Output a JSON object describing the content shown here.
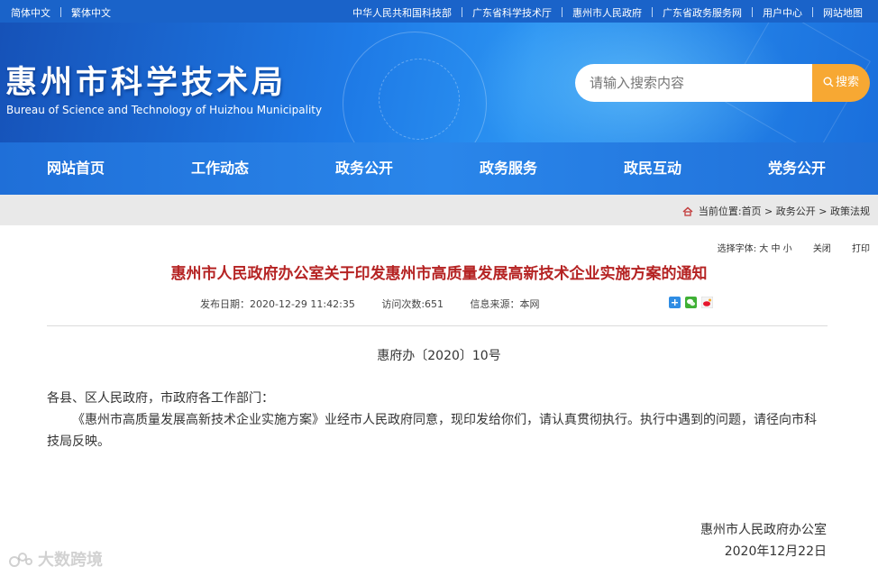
{
  "topbar": {
    "lang_simplified": "简体中文",
    "lang_traditional": "繁体中文",
    "links": [
      "中华人民共和国科技部",
      "广东省科学技术厅",
      "惠州市人民政府",
      "广东省政务服务网",
      "用户中心",
      "网站地图"
    ]
  },
  "header": {
    "title": "惠州市科学技术局",
    "subtitle": "Bureau of Science and Technology of Huizhou Municipality",
    "search_placeholder": "请输入搜索内容",
    "search_button": "搜索"
  },
  "nav": [
    "网站首页",
    "工作动态",
    "政务公开",
    "政务服务",
    "政民互动",
    "党务公开"
  ],
  "breadcrumb": {
    "prefix": "当前位置",
    "items": [
      "首页",
      "政务公开",
      "政策法规"
    ]
  },
  "tools": {
    "font_label": "选择字体",
    "sizes": [
      "大",
      "中",
      "小"
    ],
    "close": "关闭",
    "print": "打印"
  },
  "article": {
    "title": "惠州市人民政府办公室关于印发惠州市高质量发展高新技术企业实施方案的通知",
    "publish_date_label": "发布日期：2020-12-29 11:42:35",
    "visits_label": "访问次数:651",
    "source_label": "信息来源：本网",
    "doc_no": "惠府办〔2020〕10号",
    "salutation": "各县、区人民政府，市政府各工作部门：",
    "paragraph": "《惠州市高质量发展高新技术企业实施方案》业经市人民政府同意，现印发给你们，请认真贯彻执行。执行中遇到的问题，请径向市科技局反映。",
    "signer": "惠州市人民政府办公室",
    "sign_date": "2020年12月22日"
  },
  "watermark": "大数跨境",
  "colors": {
    "topbar": "#1a63c9",
    "nav": "#2a86ea",
    "title_red": "#b52323",
    "search_orange": "#f7a833",
    "crumb_bg": "#e9e9e9"
  }
}
